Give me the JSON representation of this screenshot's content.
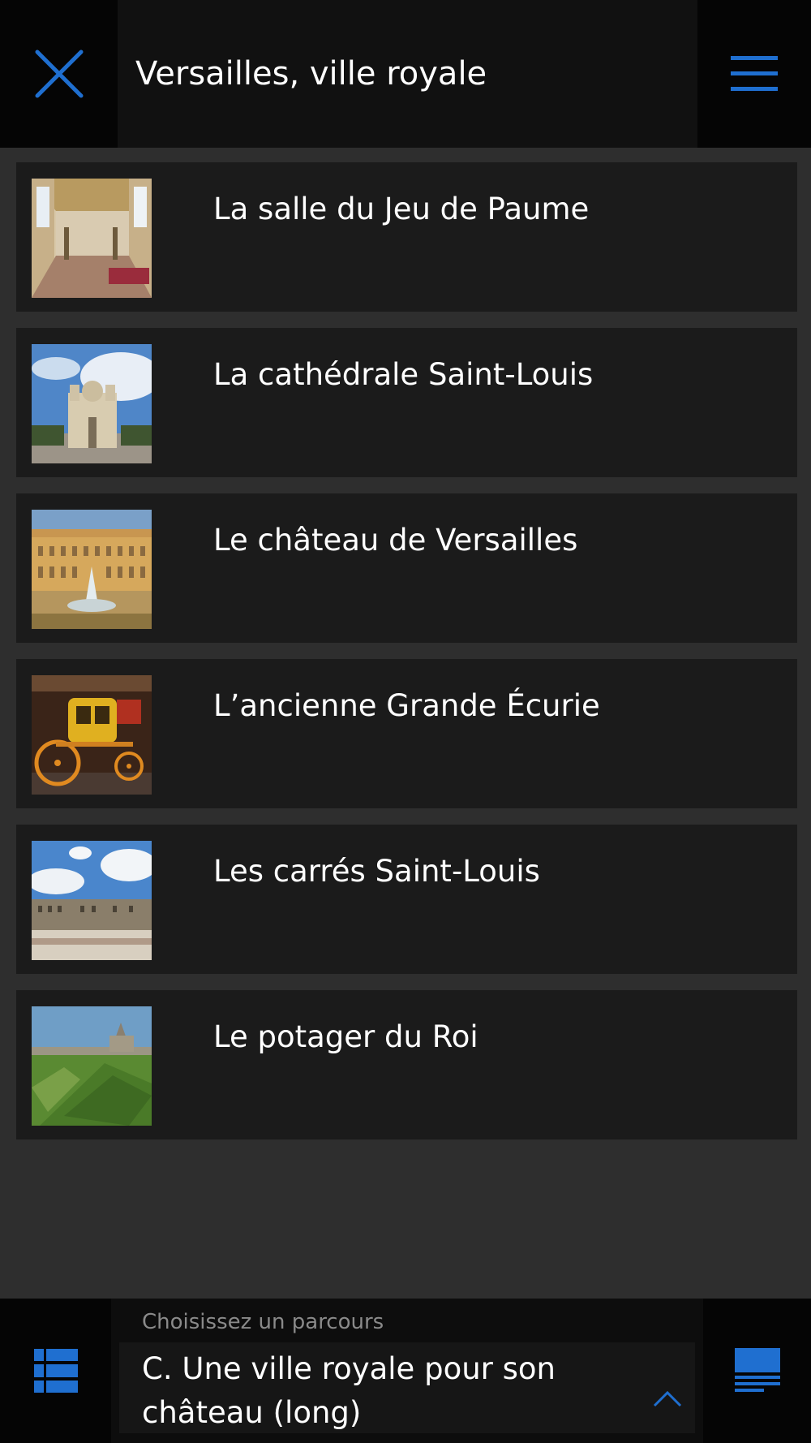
{
  "header": {
    "title": "Versailles, ville royale",
    "close_icon": "close-icon",
    "menu_icon": "hamburger-menu-icon"
  },
  "colors": {
    "accent": "#1f6fd0",
    "background": "#2e2e2e",
    "item_background": "#1b1b1b",
    "header_background": "#111111"
  },
  "list": {
    "items": [
      {
        "label": "La salle du Jeu de Paume",
        "thumbnail": "jeu-de-paume-hall-photo"
      },
      {
        "label": "La cathédrale Saint-Louis",
        "thumbnail": "cathedrale-saint-louis-photo"
      },
      {
        "label": "Le château de Versailles",
        "thumbnail": "chateau-de-versailles-photo"
      },
      {
        "label": "L’ancienne Grande Écurie",
        "thumbnail": "golden-carriage-photo"
      },
      {
        "label": "Les carrés Saint-Louis",
        "thumbnail": "carres-saint-louis-street-photo"
      },
      {
        "label": "Le potager du Roi",
        "thumbnail": "potager-du-roi-garden-photo"
      }
    ]
  },
  "footer": {
    "route_hint": "Choisissez un parcours",
    "route_value": "C. Une ville royale pour son château (long)",
    "list_icon": "list-view-icon",
    "detail_icon": "detail-view-icon",
    "chevron_icon": "chevron-up-icon"
  }
}
